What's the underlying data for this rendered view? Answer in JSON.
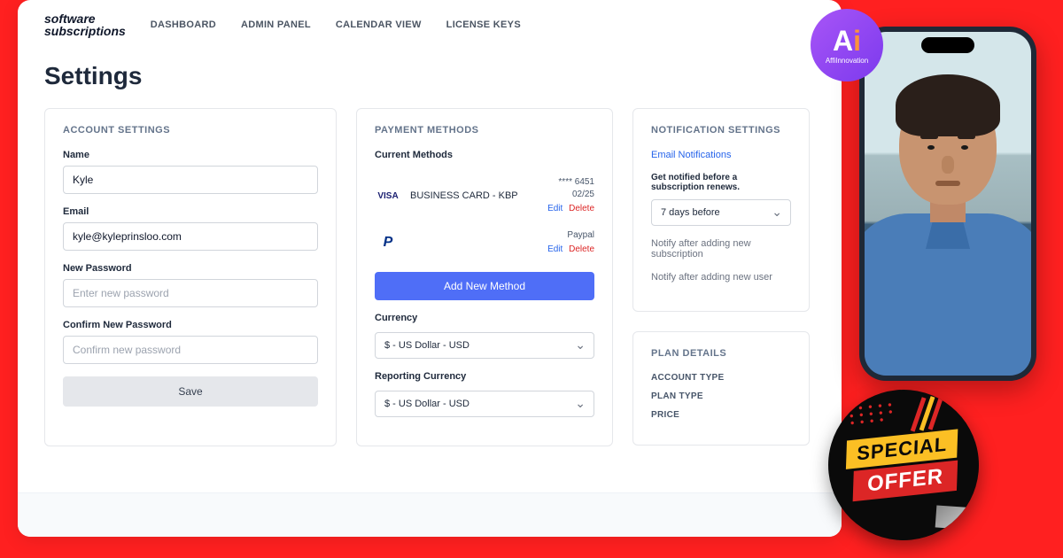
{
  "logo": {
    "line1": "software",
    "line2": "subscriptions"
  },
  "nav": [
    "DASHBOARD",
    "ADMIN PANEL",
    "CALENDAR VIEW",
    "LICENSE KEYS"
  ],
  "page_title": "Settings",
  "account": {
    "title": "ACCOUNT SETTINGS",
    "name_label": "Name",
    "name_value": "Kyle",
    "email_label": "Email",
    "email_value": "kyle@kyleprinsloo.com",
    "newpw_label": "New Password",
    "newpw_placeholder": "Enter new password",
    "confirmpw_label": "Confirm New Password",
    "confirmpw_placeholder": "Confirm new password",
    "save_label": "Save"
  },
  "payment": {
    "title": "PAYMENT METHODS",
    "current_label": "Current Methods",
    "methods": [
      {
        "brand": "VISA",
        "name": "BUSINESS CARD - KBP",
        "last4": "**** 6451",
        "exp": "02/25"
      },
      {
        "brand": "P",
        "name": "",
        "right": "Paypal"
      }
    ],
    "edit": "Edit",
    "delete": "Delete",
    "add_label": "Add New Method",
    "currency_label": "Currency",
    "currency_value": "$ - US Dollar - USD",
    "reporting_label": "Reporting Currency",
    "reporting_value": "$ - US Dollar - USD"
  },
  "notif": {
    "title": "NOTIFICATION SETTINGS",
    "email_link": "Email Notifications",
    "renew_label": "Get notified before a subscription renews.",
    "renew_value": "7 days before",
    "after_sub": "Notify after adding new subscription",
    "after_user": "Notify after adding new user"
  },
  "plan": {
    "title": "PLAN DETAILS",
    "rows": [
      "ACCOUNT TYPE",
      "PLAN TYPE",
      "PRICE"
    ]
  },
  "badge": {
    "ai_a": "A",
    "ai_i": "i",
    "sub": "AffiInnovation"
  },
  "offer": {
    "special": "SPECIAL",
    "offer": "OFFER"
  }
}
